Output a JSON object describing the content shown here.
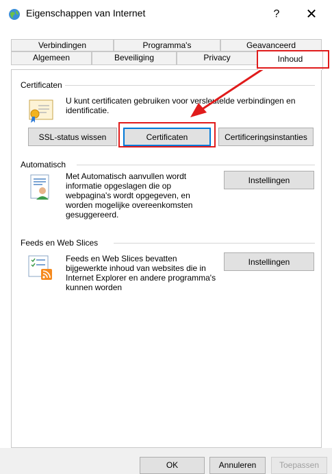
{
  "window": {
    "title": "Eigenschappen van Internet",
    "help_label": "?",
    "close_label": "✕"
  },
  "tabs": {
    "row1": [
      "Verbindingen",
      "Programma's",
      "Geavanceerd"
    ],
    "row2": [
      "Algemeen",
      "Beveiliging",
      "Privacy",
      "Inhoud"
    ],
    "active": "Inhoud"
  },
  "certificates": {
    "group_label": "Certificaten",
    "description": "U kunt certificaten gebruiken voor versleutelde verbindingen en identificatie.",
    "ssl_button": "SSL-status wissen",
    "cert_button": "Certificaten",
    "authorities_button": "Certificeringsinstanties"
  },
  "autocomplete": {
    "group_label": "Automatisch",
    "description": "Met Automatisch aanvullen wordt informatie opgeslagen die op webpagina's wordt opgegeven, en worden mogelijke overeenkomsten gesuggereerd.",
    "settings_button": "Instellingen"
  },
  "feeds": {
    "group_label": "Feeds en Web Slices",
    "description": "Feeds en Web Slices bevatten bijgewerkte inhoud van websites die in Internet Explorer en andere programma's kunnen worden",
    "settings_button": "Instellingen"
  },
  "footer": {
    "ok": "OK",
    "cancel": "Annuleren",
    "apply": "Toepassen"
  },
  "colors": {
    "highlight": "#e01b1b",
    "focus_border": "#0078d7"
  },
  "icons": {
    "title": "internet-options-icon",
    "certificate": "certificate-icon",
    "autocomplete": "autocomplete-icon",
    "feeds": "feeds-icon"
  }
}
